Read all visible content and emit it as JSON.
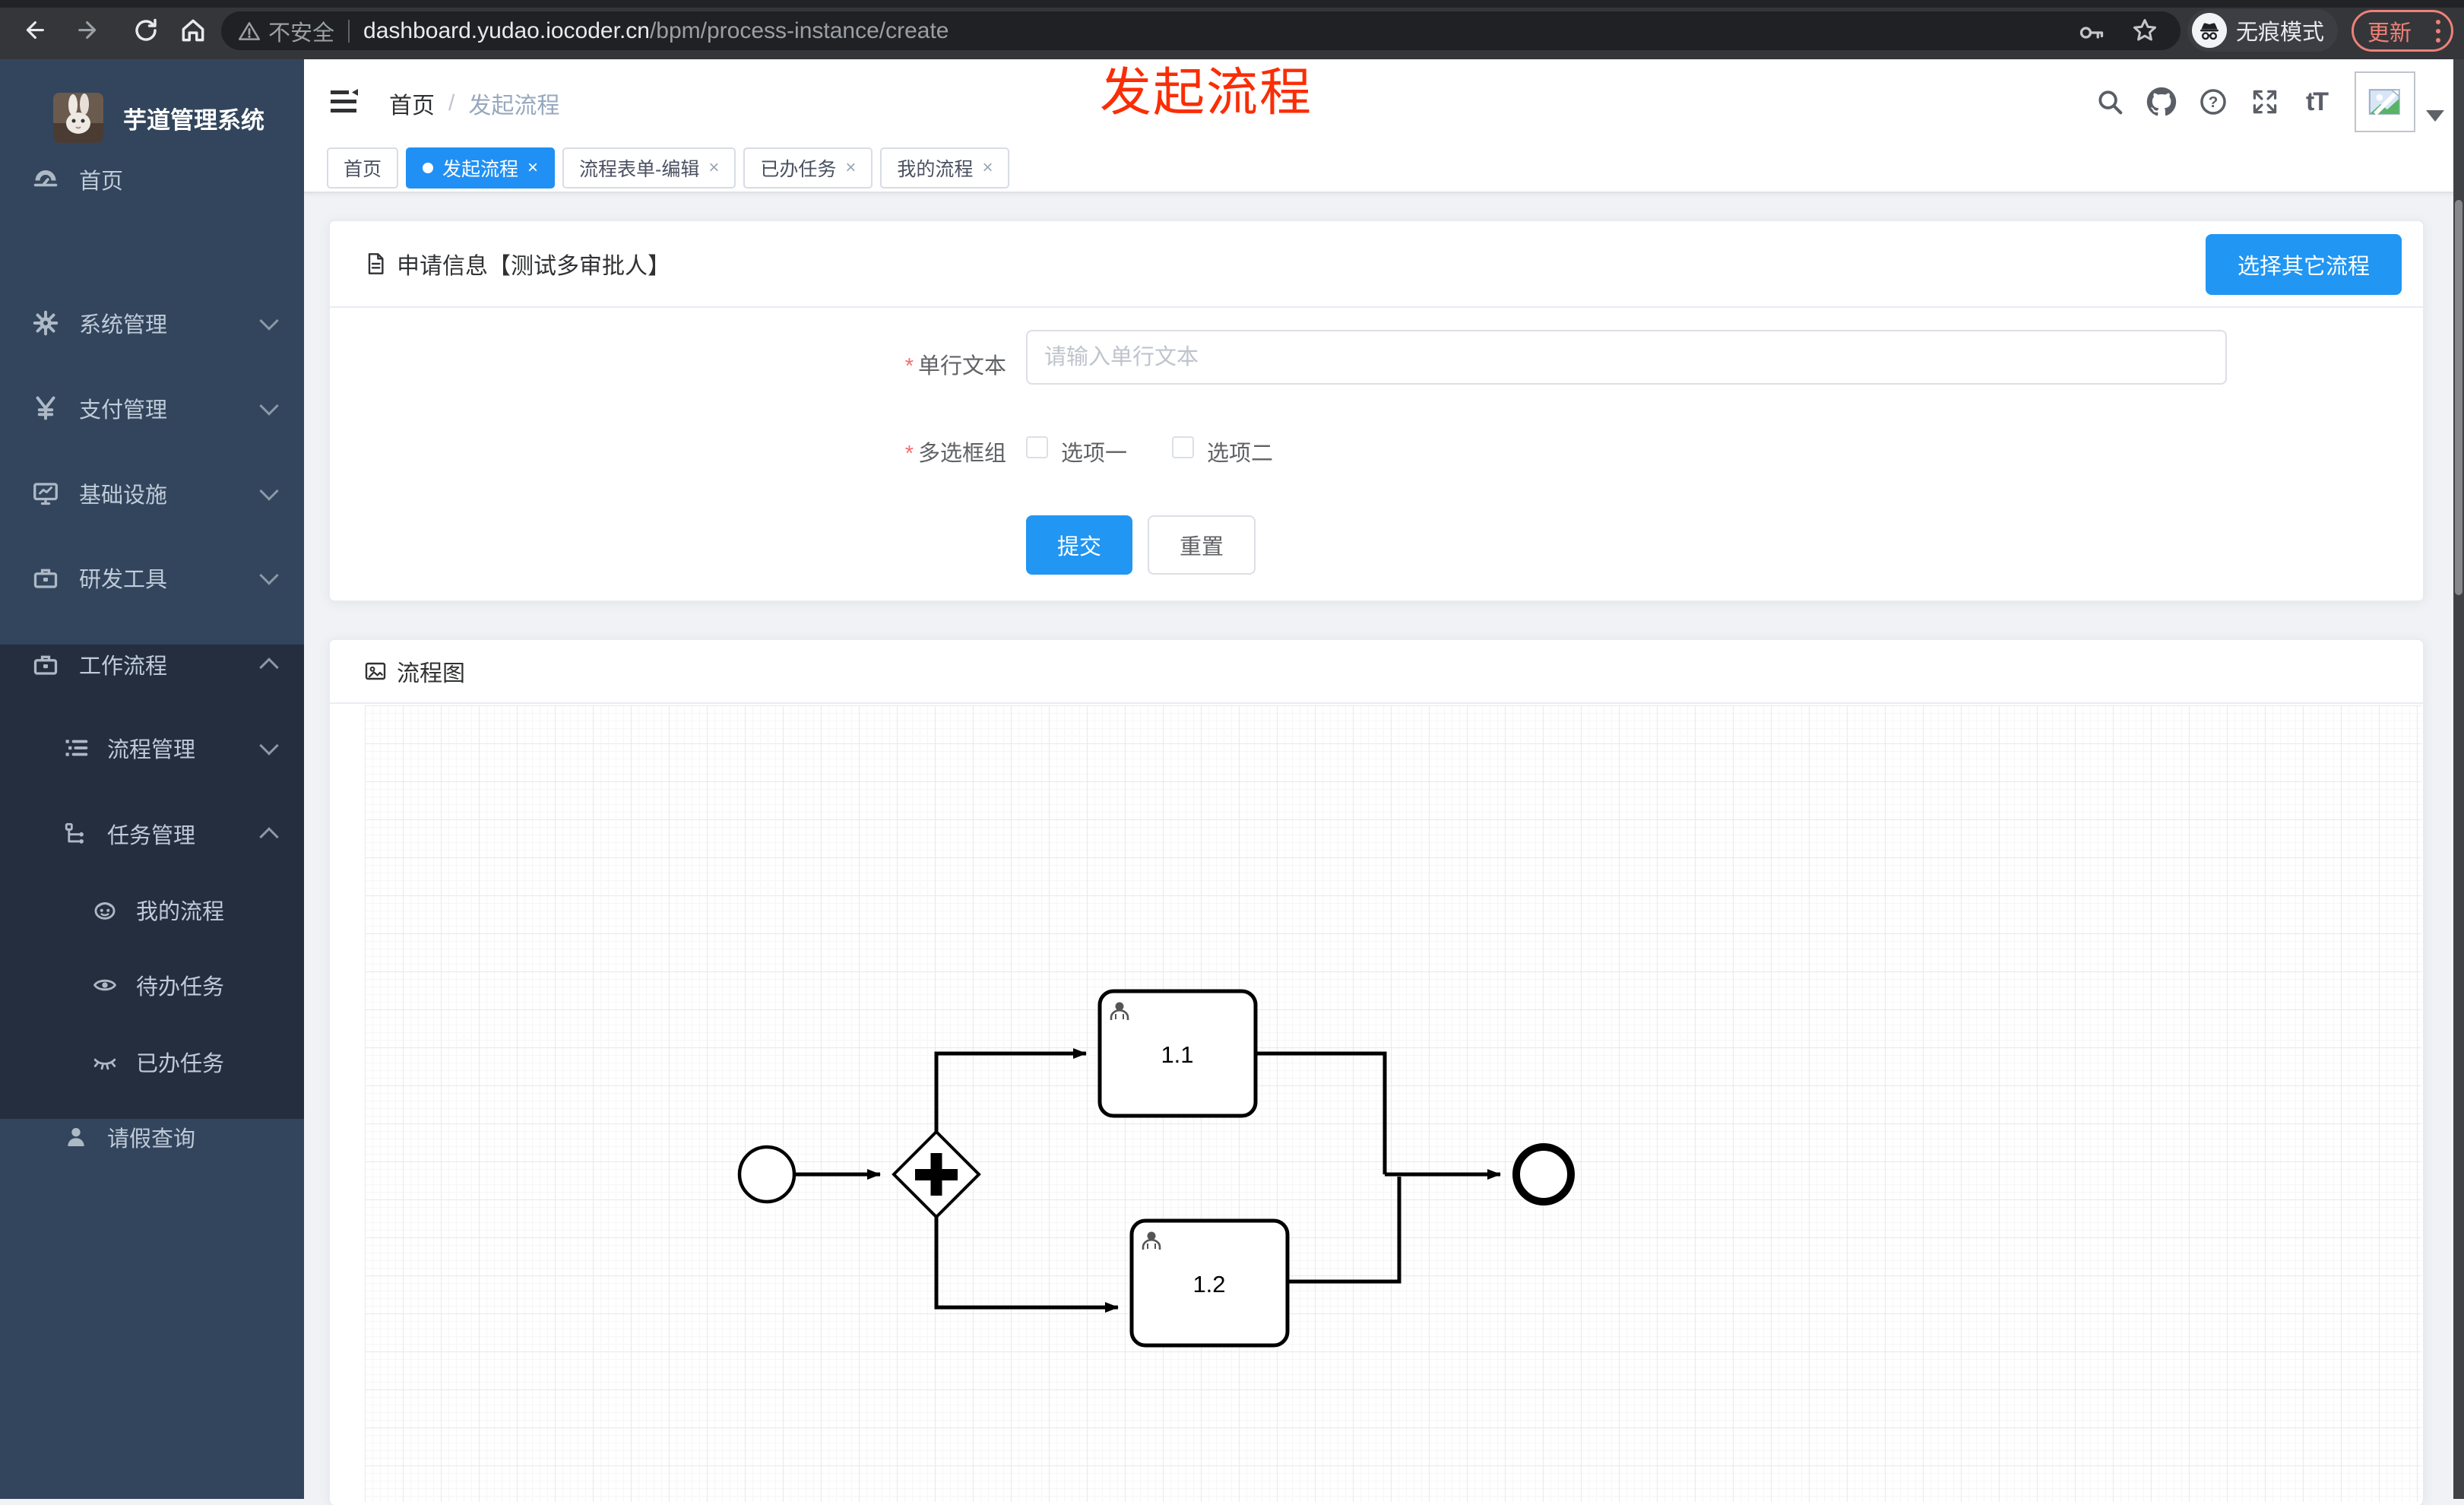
{
  "browser": {
    "security_label": "不安全",
    "url_host": "dashboard.yudao.iocoder.cn",
    "url_path": "/bpm/process-instance/create",
    "incognito_label": "无痕模式",
    "update_label": "更新"
  },
  "overlay": {
    "title": "发起流程"
  },
  "sidebar": {
    "app_title": "芋道管理系统",
    "items": [
      {
        "label": "首页"
      },
      {
        "label": "系统管理"
      },
      {
        "label": "支付管理"
      },
      {
        "label": "基础设施"
      },
      {
        "label": "研发工具"
      },
      {
        "label": "工作流程"
      },
      {
        "label": "流程管理"
      },
      {
        "label": "任务管理"
      },
      {
        "label": "我的流程"
      },
      {
        "label": "待办任务"
      },
      {
        "label": "已办任务"
      },
      {
        "label": "请假查询"
      }
    ]
  },
  "header": {
    "breadcrumb_home": "首页",
    "breadcrumb_sep": "/",
    "breadcrumb_current": "发起流程"
  },
  "tabs": {
    "close_glyph": "×",
    "items": [
      {
        "label": "首页",
        "active": false,
        "closable": false
      },
      {
        "label": "发起流程",
        "active": true,
        "closable": true
      },
      {
        "label": "流程表单-编辑",
        "active": false,
        "closable": true
      },
      {
        "label": "已办任务",
        "active": false,
        "closable": true
      },
      {
        "label": "我的流程",
        "active": false,
        "closable": true
      }
    ]
  },
  "form_card": {
    "title": "申请信息【测试多审批人】",
    "action_button": "选择其它流程",
    "required_mark": "*",
    "fields": {
      "text_label": "单行文本",
      "text_placeholder": "请输入单行文本",
      "text_value": "",
      "checkbox_label": "多选框组",
      "options": [
        "选项一",
        "选项二"
      ]
    },
    "submit_label": "提交",
    "reset_label": "重置"
  },
  "diagram_card": {
    "title": "流程图",
    "tasks": [
      {
        "label": "1.1"
      },
      {
        "label": "1.2"
      }
    ]
  },
  "icons": {
    "help_glyph": "?",
    "font_size_glyph": "tT"
  },
  "colors": {
    "primary": "#2196f3",
    "tag_active": "#2190f5",
    "sidebar_bg": "#32455c",
    "submenu_bg": "#242e3e",
    "annotation_red": "#fa2d05",
    "update_salmon": "#ee8177"
  }
}
